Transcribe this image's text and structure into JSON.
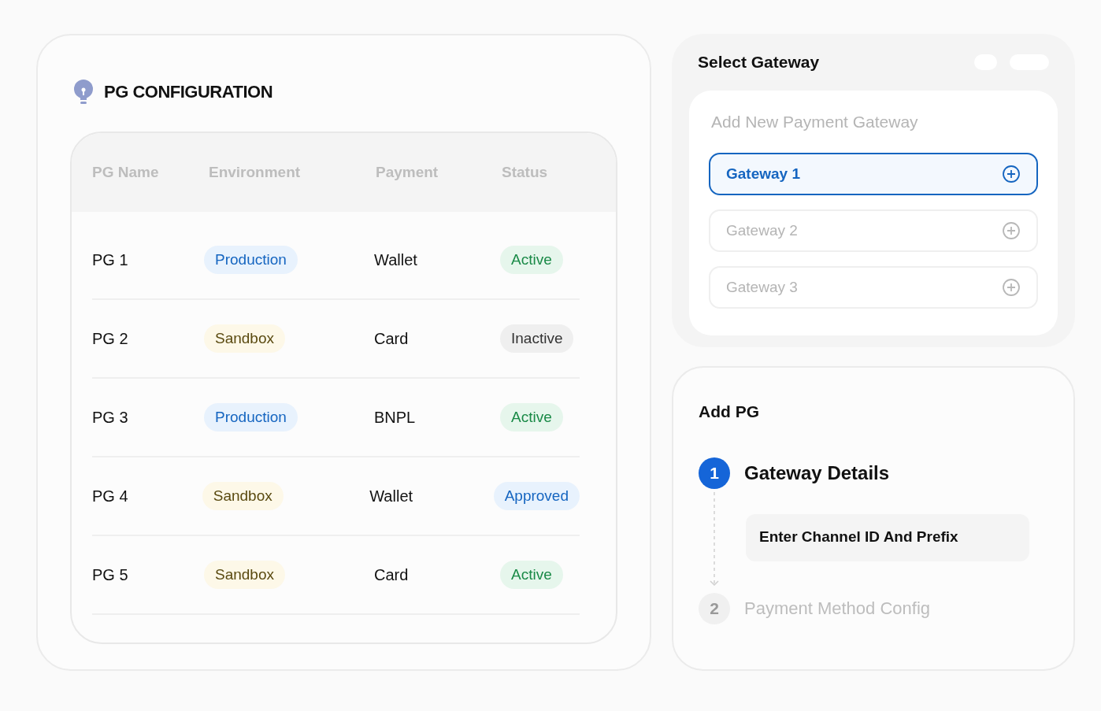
{
  "config": {
    "title": "PG CONFIGURATION",
    "columns": [
      "PG Name",
      "Environment",
      "Payment",
      "Status"
    ],
    "rows": [
      {
        "name": "PG 1",
        "environment": {
          "label": "Production",
          "kind": "production"
        },
        "payment": "Wallet",
        "status": {
          "label": "Active",
          "kind": "active"
        }
      },
      {
        "name": "PG 2",
        "environment": {
          "label": "Sandbox",
          "kind": "sandbox"
        },
        "payment": "Card",
        "status": {
          "label": "Inactive",
          "kind": "inactive"
        }
      },
      {
        "name": "PG 3",
        "environment": {
          "label": "Production",
          "kind": "production"
        },
        "payment": "BNPL",
        "status": {
          "label": "Active",
          "kind": "active"
        }
      },
      {
        "name": "PG 4",
        "environment": {
          "label": "Sandbox",
          "kind": "sandbox"
        },
        "payment": "Wallet",
        "status": {
          "label": "Approved",
          "kind": "approved"
        }
      },
      {
        "name": "PG 5",
        "environment": {
          "label": "Sandbox",
          "kind": "sandbox"
        },
        "payment": "Card",
        "status": {
          "label": "Active",
          "kind": "active"
        }
      }
    ]
  },
  "select_gateway": {
    "title": "Select Gateway",
    "subtitle": "Add New Payment Gateway",
    "gateways": [
      {
        "label": "Gateway 1",
        "selected": true
      },
      {
        "label": "Gateway 2",
        "selected": false
      },
      {
        "label": "Gateway 3",
        "selected": false
      }
    ]
  },
  "add_pg": {
    "title": "Add PG",
    "steps": [
      {
        "number": "1",
        "label": "Gateway Details",
        "active": true,
        "field": "Enter Channel ID And Prefix"
      },
      {
        "number": "2",
        "label": "Payment Method Config",
        "active": false
      }
    ]
  }
}
